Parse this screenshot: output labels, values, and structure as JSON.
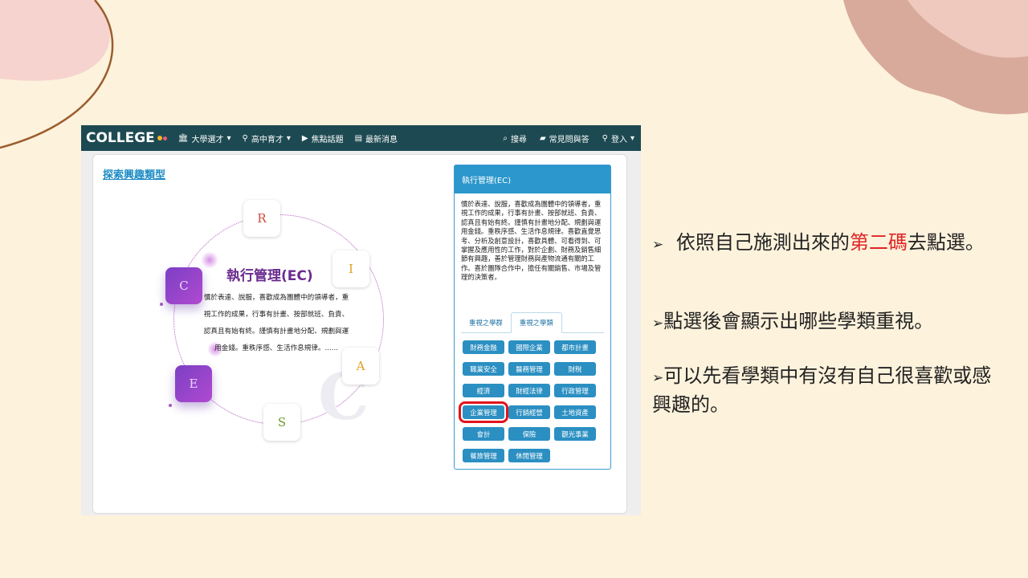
{
  "slide": {
    "bullets": [
      {
        "marker": "➢",
        "text_before": " 依照自己施測出來的",
        "highlight": "第二碼",
        "text_after": "去點選。"
      },
      {
        "marker": "➢",
        "text": "點選後會顯示出哪些學類重視。"
      },
      {
        "marker": "➢",
        "text": "可以先看學類中有沒有自己很喜歡或感興趣的。"
      }
    ],
    "colors": {
      "background": "#fdf2dc",
      "highlight": "#e02424",
      "deco_pink": "#f4cdc8",
      "deco_brown": "#9b5d2e"
    }
  },
  "navbar": {
    "logo": "COLLEGE",
    "items": [
      {
        "icon": "university-icon",
        "label": "大學選才",
        "dropdown": true
      },
      {
        "icon": "user-icon",
        "label": "高中育才",
        "dropdown": true
      },
      {
        "icon": "play-icon",
        "label": "焦點話題"
      },
      {
        "icon": "news-icon",
        "label": "最新消息"
      }
    ],
    "right": [
      {
        "icon": "search-icon",
        "label": "搜尋"
      },
      {
        "icon": "chat-icon",
        "label": "常見問與答"
      },
      {
        "icon": "user-icon",
        "label": "登入",
        "dropdown": true
      }
    ],
    "colors": {
      "bar": "#1d4a52"
    }
  },
  "explore_title": "探索興趣類型",
  "riasec": [
    "R",
    "I",
    "A",
    "S",
    "E",
    "C"
  ],
  "riasec_active": [
    "C",
    "E"
  ],
  "center": {
    "title": "執行管理(EC)",
    "desc": "慣於表達、說服，喜歡成為團體中的領導者，重視工作的成果，行事有計畫、按部就班、負責、認真且有始有終。謹慎有計畫地分配、規劃與運用金錢。重秩序感、生活作息規律。......"
  },
  "panel": {
    "title": "執行管理(EC)",
    "desc": "慣於表達、說服，喜歡成為團體中的領導者，重視工作的成果，行事有計畫、按部就班、負責、認真且有始有終。謹慎有計畫地分配、規劃與運用金錢。重秩序感、生活作息規律。喜歡直覺思考、分析及創意設計，喜歡具體、可看得到、可掌握及應用性的工作，對於企劃、財務及銷售細節有興趣，善於管理財務與產物流通有關的工作。喜於團隊合作中，擔任有關銷售、市場及管理的決策者。",
    "tabs": [
      "重視之學群",
      "重視之學類"
    ],
    "active_tab": 1,
    "majors": [
      "財務金融",
      "國際企業",
      "都市計畫",
      "職業安全",
      "醫務管理",
      "財稅",
      "經濟",
      "財經法律",
      "行政管理",
      "企業管理",
      "行銷經營",
      "土地資產",
      "會計",
      "保險",
      "觀光事業",
      "餐旅管理",
      "休閒管理"
    ],
    "highlighted_major": "企業管理",
    "colors": {
      "header": "#2b97cc",
      "major": "#2b8fc2",
      "highlight_box": "#e2141b"
    }
  }
}
